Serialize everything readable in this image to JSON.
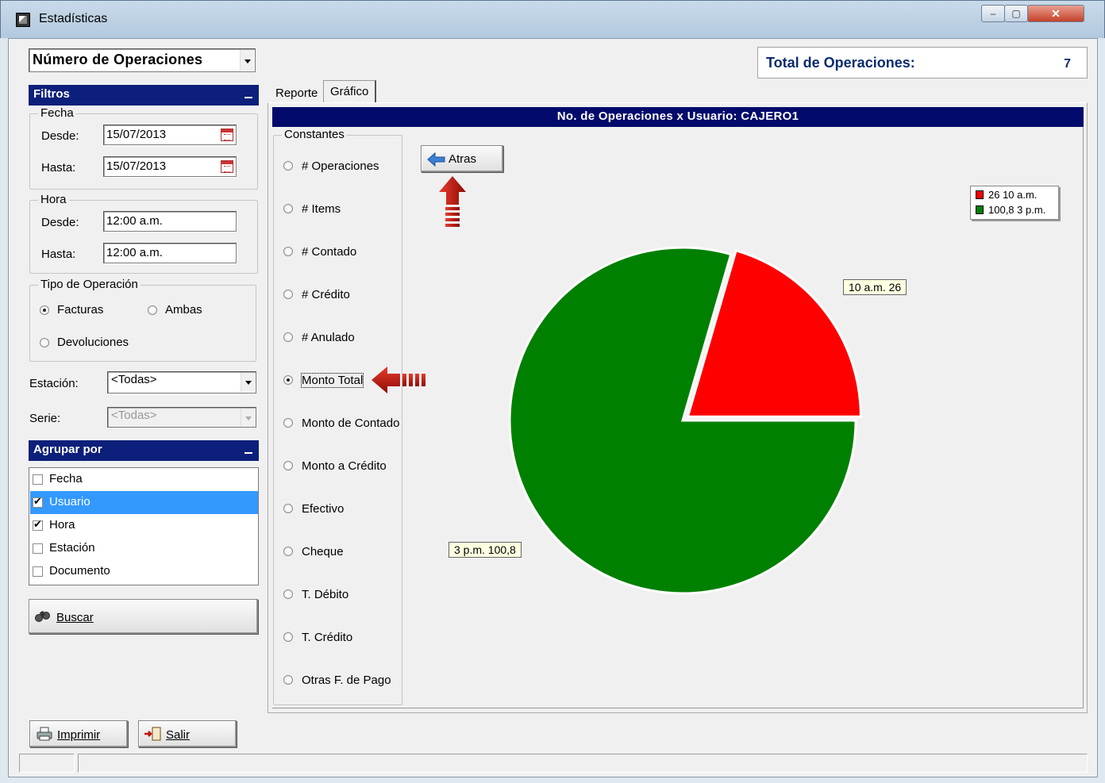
{
  "window": {
    "title": "Estadísticas",
    "controls": {
      "minimize": "‒",
      "maximize": "▢",
      "close": "✕"
    }
  },
  "operation_selector": {
    "value": "Número de Operaciones"
  },
  "total": {
    "label": "Total de Operaciones:",
    "value": "7"
  },
  "filtros": {
    "header": "Filtros",
    "fecha": {
      "legend": "Fecha",
      "desde_label": "Desde:",
      "desde_value": "15/07/2013",
      "hasta_label": "Hasta:",
      "hasta_value": "15/07/2013"
    },
    "hora": {
      "legend": "Hora",
      "desde_label": "Desde:",
      "desde_value": "12:00 a.m.",
      "hasta_label": "Hasta:",
      "hasta_value": "12:00 a.m."
    },
    "tipo": {
      "legend": "Tipo de Operación",
      "options": [
        "Facturas",
        "Ambas",
        "Devoluciones"
      ],
      "selected": "Facturas"
    },
    "estacion": {
      "label": "Estación:",
      "value": "<Todas>"
    },
    "serie": {
      "label": "Serie:",
      "value": "<Todas>"
    }
  },
  "agrupar": {
    "header": "Agrupar por",
    "items": [
      {
        "label": "Fecha",
        "checked": false,
        "selected": false
      },
      {
        "label": "Usuario",
        "checked": true,
        "selected": true
      },
      {
        "label": "Hora",
        "checked": true,
        "selected": false
      },
      {
        "label": "Estación",
        "checked": false,
        "selected": false
      },
      {
        "label": "Documento",
        "checked": false,
        "selected": false
      }
    ]
  },
  "buttons": {
    "buscar": "Buscar",
    "imprimir": "Imprimir",
    "salir": "Salir",
    "atras": "Atras"
  },
  "tabs": [
    {
      "label": "Reporte",
      "active": false
    },
    {
      "label": "Gráfico",
      "active": true
    }
  ],
  "constantes": {
    "legend": "Constantes",
    "items": [
      "# Operaciones",
      "# Items",
      "# Contado",
      "# Crédito",
      "# Anulado",
      "Monto Total",
      "Monto de Contado",
      "Monto a Crédito",
      "Efectivo",
      "Cheque",
      "T. Débito",
      "T. Crédito",
      "Otras F. de Pago"
    ],
    "selected": "Monto Total"
  },
  "colors": {
    "header_bg": "#0c1f7a",
    "title_bar_bg": "#020b6b",
    "total_text": "#0a2c6e",
    "selection": "#3399ff",
    "annotation_arrow": "#c0140c"
  },
  "chart_data": {
    "type": "pie",
    "title": "No. de Operaciones x Usuario: CAJERO1",
    "slices": [
      {
        "category": "10 a.m.",
        "value": 26,
        "value_text": "26",
        "color": "#ff0000",
        "legend": "26 10 a.m.",
        "label": "10 a.m. 26"
      },
      {
        "category": "3 p.m.",
        "value": 100.8,
        "value_text": "100,8",
        "color": "#008000",
        "legend": "100,8 3 p.m.",
        "label": "3 p.m. 100,8"
      }
    ],
    "legend_position": "top-right"
  }
}
